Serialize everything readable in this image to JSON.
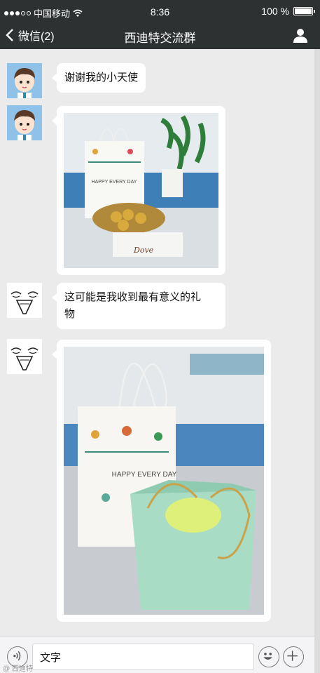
{
  "status_bar": {
    "carrier": "中国移动",
    "time": "8:36",
    "battery": "100 %"
  },
  "nav": {
    "back_label": "微信(2)",
    "title": "西迪特交流群"
  },
  "messages": [
    {
      "type": "text",
      "text": "谢谢我的小天使",
      "avatar": "boy-avatar"
    },
    {
      "type": "image",
      "avatar": "boy-avatar",
      "image_text": "HAPPY EVERY DAY",
      "brand_text": "Dove"
    },
    {
      "type": "text",
      "text_lines": [
        "这可能是我收到最有意义的礼",
        "物"
      ],
      "avatar": "face-avatar"
    },
    {
      "type": "image",
      "avatar": "face-avatar",
      "image_text": "HAPPY EVERY DAY"
    }
  ],
  "input_bar": {
    "input_value": "文字"
  },
  "watermark": "@ 西迪特"
}
